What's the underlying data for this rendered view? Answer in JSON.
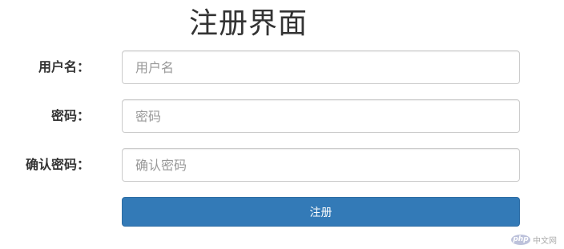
{
  "page": {
    "title": "注册界面"
  },
  "form": {
    "fields": [
      {
        "label": "用户名：",
        "placeholder": "用户名",
        "value": ""
      },
      {
        "label": "密码：",
        "placeholder": "密码",
        "value": ""
      },
      {
        "label": "确认密码：",
        "placeholder": "确认密码",
        "value": ""
      }
    ],
    "submit_label": "注册"
  },
  "watermark": {
    "logo": "php",
    "text": "中文网"
  },
  "colors": {
    "primary": "#337ab7",
    "border": "#cccccc",
    "text": "#333333",
    "placeholder": "#999999"
  }
}
